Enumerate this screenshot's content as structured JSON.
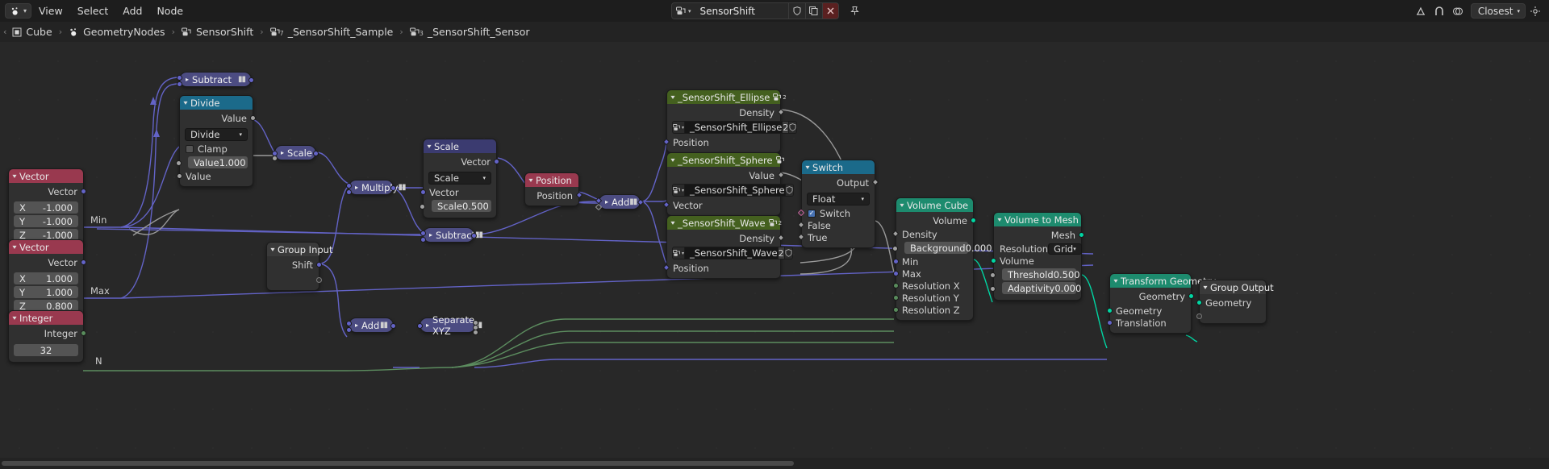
{
  "window": {
    "editor_type": "geometry-node-editor",
    "menus": [
      "View",
      "Select",
      "Add",
      "Node"
    ]
  },
  "id_block": {
    "datablock_name": "SensorShift",
    "icons": [
      "node-tree-icon",
      "shield-icon",
      "copy-icon",
      "delete-icon"
    ],
    "pin_icon": "pin-icon"
  },
  "topbar_right": {
    "icons": [
      "proportional-edit-icon",
      "snap-magnet-icon",
      "overlay-icon"
    ],
    "snap_label": "Closest",
    "options_icon": "options-icon"
  },
  "breadcrumb": {
    "items": [
      {
        "label": "Cube",
        "icon": "object-icon"
      },
      {
        "label": "GeometryNodes",
        "icon": "modifier-icon"
      },
      {
        "label": "SensorShift",
        "icon": "nodetree-icon"
      },
      {
        "label": "_SensorShift_Sample",
        "icon": "nodegroup-icon",
        "badge": "7"
      },
      {
        "label": "_SensorShift_Sensor",
        "icon": "nodegroup-icon",
        "badge": "3"
      }
    ],
    "separator": "›"
  },
  "nodes": {
    "vector_min": {
      "title": "Vector",
      "output_label": "Vector",
      "fields": [
        {
          "label": "X",
          "value": "-1.000"
        },
        {
          "label": "Y",
          "value": "-1.000"
        },
        {
          "label": "Z",
          "value": "-1.000"
        }
      ]
    },
    "vector_max": {
      "title": "Vector",
      "output_label": "Vector",
      "fields": [
        {
          "label": "X",
          "value": "1.000"
        },
        {
          "label": "Y",
          "value": "1.000"
        },
        {
          "label": "Z",
          "value": "0.800"
        }
      ]
    },
    "integer": {
      "title": "Integer",
      "output_label": "Integer",
      "value": "32"
    },
    "subtract_top": {
      "title": "Subtract"
    },
    "divide": {
      "title": "Divide",
      "output_label": "Value",
      "operation": "Divide",
      "clamp_label": "Clamp",
      "clamp_checked": false,
      "input_value_label": "Value",
      "input_value": "1.000",
      "input_value2_label": "Value"
    },
    "scale_small": {
      "title": "Scale"
    },
    "multiply": {
      "title": "Multiply"
    },
    "subtract_mid": {
      "title": "Subtract"
    },
    "group_input": {
      "title": "Group Input",
      "output_label": "Shift"
    },
    "scale_node": {
      "title": "Scale",
      "output_label": "Vector",
      "operation": "Scale",
      "vector_label": "Vector",
      "scale_label": "Scale",
      "scale_value": "0.500"
    },
    "position": {
      "title": "Position",
      "output_label": "Position"
    },
    "add_mid": {
      "title": "Add"
    },
    "ss_ellipse": {
      "title": "_SensorShift_Ellipse",
      "output_label": "Density",
      "object_name": "_SensorShift_Ellipse",
      "users_count": "2",
      "input_label": "Position",
      "header_badge": "2"
    },
    "ss_sphere": {
      "title": "_SensorShift_Sphere",
      "output_label": "Value",
      "object_name": "_SensorShift_Sphere",
      "users_count": "",
      "input_label": "Vector",
      "header_badge": ""
    },
    "ss_wave": {
      "title": "_SensorShift_Wave",
      "output_label": "Density",
      "object_name": "_SensorShift_Wave",
      "users_count": "2",
      "input_label": "Position",
      "header_badge": "2"
    },
    "switch": {
      "title": "Switch",
      "output_label": "Output",
      "data_type": "Float",
      "switch_label": "Switch",
      "switch_checked": true,
      "false_label": "False",
      "true_label": "True"
    },
    "volume_cube": {
      "title": "Volume Cube",
      "output_label": "Volume",
      "density_label": "Density",
      "background_label": "Background",
      "background_value": "0.000",
      "min_label": "Min",
      "max_label": "Max",
      "res_x_label": "Resolution X",
      "res_y_label": "Resolution Y",
      "res_z_label": "Resolution Z"
    },
    "volume_to_mesh": {
      "title": "Volume to Mesh",
      "output_label": "Mesh",
      "resolution_label": "Resolution",
      "resolution_mode": "Grid",
      "volume_label": "Volume",
      "threshold_label": "Threshold",
      "threshold_value": "0.500",
      "adaptivity_label": "Adaptivity",
      "adaptivity_value": "0.000"
    },
    "transform_geometry": {
      "title": "Transform Geometry",
      "output_label": "Geometry",
      "geometry_label": "Geometry",
      "translation_label": "Translation"
    },
    "group_output": {
      "title": "Group Output",
      "geometry_label": "Geometry"
    }
  },
  "wire_labels": {
    "min": "Min",
    "max": "Max",
    "n": "N"
  },
  "colors": {
    "bg": "#282828",
    "header_red": "#99394f",
    "header_blue": "#3b3b70",
    "header_cyan": "#1b6a8a",
    "header_green": "#44601f",
    "header_teal": "#1d8b6e",
    "wire_vector": "#6363c7",
    "wire_geometry": "#00d6a3",
    "wire_float": "#9a9a9a",
    "wire_int": "#5c8d5f"
  }
}
